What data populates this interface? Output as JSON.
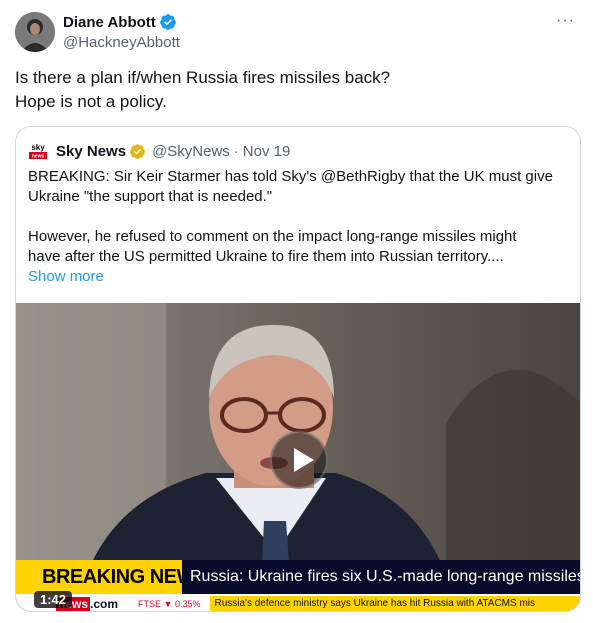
{
  "author": {
    "name": "Diane Abbott",
    "handle": "@HackneyAbbott"
  },
  "more_label": "···",
  "tweet_lines": [
    "Is there a plan if/when Russia fires missiles back?",
    "Hope is not a policy."
  ],
  "quote": {
    "logo_text": "sky",
    "name": "Sky News",
    "handle": "@SkyNews",
    "separator": "·",
    "date": "Nov 19",
    "lines": [
      "BREAKING: Sir Keir Starmer has told Sky's @BethRigby that the UK must give",
      "Ukraine \"the support that is needed.\"",
      "However, he refused to comment on the impact long-range missiles might",
      "have after the US permitted Ukraine to fire them into Russian territory...."
    ],
    "show_more": "Show more"
  },
  "video": {
    "breaking_label": "BREAKING NEWS",
    "headline": "Russia: Ukraine fires six U.S.-made long-range missiles",
    "channel_mini_a": "news",
    "channel_mini_b": ".com",
    "ftse": "FTSE ▼ 0.35%",
    "ticker": "Russia's defence ministry says Ukraine has hit Russia with ATACMS mis",
    "duration": "1:42"
  },
  "colors": {
    "link": "#1d9bf0",
    "verified": "#1d9bf0",
    "breaking_bg": "#ffd200",
    "headline_bg": "#0a0a2a"
  }
}
